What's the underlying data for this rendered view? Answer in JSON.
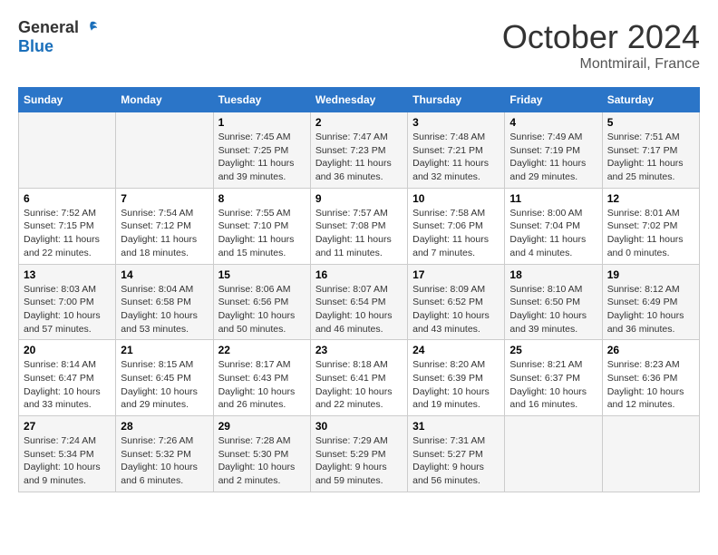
{
  "logo": {
    "general": "General",
    "blue": "Blue"
  },
  "header": {
    "month": "October 2024",
    "location": "Montmirail, France"
  },
  "weekdays": [
    "Sunday",
    "Monday",
    "Tuesday",
    "Wednesday",
    "Thursday",
    "Friday",
    "Saturday"
  ],
  "weeks": [
    [
      {
        "day": "",
        "sunrise": "",
        "sunset": "",
        "daylight": ""
      },
      {
        "day": "",
        "sunrise": "",
        "sunset": "",
        "daylight": ""
      },
      {
        "day": "1",
        "sunrise": "Sunrise: 7:45 AM",
        "sunset": "Sunset: 7:25 PM",
        "daylight": "Daylight: 11 hours and 39 minutes."
      },
      {
        "day": "2",
        "sunrise": "Sunrise: 7:47 AM",
        "sunset": "Sunset: 7:23 PM",
        "daylight": "Daylight: 11 hours and 36 minutes."
      },
      {
        "day": "3",
        "sunrise": "Sunrise: 7:48 AM",
        "sunset": "Sunset: 7:21 PM",
        "daylight": "Daylight: 11 hours and 32 minutes."
      },
      {
        "day": "4",
        "sunrise": "Sunrise: 7:49 AM",
        "sunset": "Sunset: 7:19 PM",
        "daylight": "Daylight: 11 hours and 29 minutes."
      },
      {
        "day": "5",
        "sunrise": "Sunrise: 7:51 AM",
        "sunset": "Sunset: 7:17 PM",
        "daylight": "Daylight: 11 hours and 25 minutes."
      }
    ],
    [
      {
        "day": "6",
        "sunrise": "Sunrise: 7:52 AM",
        "sunset": "Sunset: 7:15 PM",
        "daylight": "Daylight: 11 hours and 22 minutes."
      },
      {
        "day": "7",
        "sunrise": "Sunrise: 7:54 AM",
        "sunset": "Sunset: 7:12 PM",
        "daylight": "Daylight: 11 hours and 18 minutes."
      },
      {
        "day": "8",
        "sunrise": "Sunrise: 7:55 AM",
        "sunset": "Sunset: 7:10 PM",
        "daylight": "Daylight: 11 hours and 15 minutes."
      },
      {
        "day": "9",
        "sunrise": "Sunrise: 7:57 AM",
        "sunset": "Sunset: 7:08 PM",
        "daylight": "Daylight: 11 hours and 11 minutes."
      },
      {
        "day": "10",
        "sunrise": "Sunrise: 7:58 AM",
        "sunset": "Sunset: 7:06 PM",
        "daylight": "Daylight: 11 hours and 7 minutes."
      },
      {
        "day": "11",
        "sunrise": "Sunrise: 8:00 AM",
        "sunset": "Sunset: 7:04 PM",
        "daylight": "Daylight: 11 hours and 4 minutes."
      },
      {
        "day": "12",
        "sunrise": "Sunrise: 8:01 AM",
        "sunset": "Sunset: 7:02 PM",
        "daylight": "Daylight: 11 hours and 0 minutes."
      }
    ],
    [
      {
        "day": "13",
        "sunrise": "Sunrise: 8:03 AM",
        "sunset": "Sunset: 7:00 PM",
        "daylight": "Daylight: 10 hours and 57 minutes."
      },
      {
        "day": "14",
        "sunrise": "Sunrise: 8:04 AM",
        "sunset": "Sunset: 6:58 PM",
        "daylight": "Daylight: 10 hours and 53 minutes."
      },
      {
        "day": "15",
        "sunrise": "Sunrise: 8:06 AM",
        "sunset": "Sunset: 6:56 PM",
        "daylight": "Daylight: 10 hours and 50 minutes."
      },
      {
        "day": "16",
        "sunrise": "Sunrise: 8:07 AM",
        "sunset": "Sunset: 6:54 PM",
        "daylight": "Daylight: 10 hours and 46 minutes."
      },
      {
        "day": "17",
        "sunrise": "Sunrise: 8:09 AM",
        "sunset": "Sunset: 6:52 PM",
        "daylight": "Daylight: 10 hours and 43 minutes."
      },
      {
        "day": "18",
        "sunrise": "Sunrise: 8:10 AM",
        "sunset": "Sunset: 6:50 PM",
        "daylight": "Daylight: 10 hours and 39 minutes."
      },
      {
        "day": "19",
        "sunrise": "Sunrise: 8:12 AM",
        "sunset": "Sunset: 6:49 PM",
        "daylight": "Daylight: 10 hours and 36 minutes."
      }
    ],
    [
      {
        "day": "20",
        "sunrise": "Sunrise: 8:14 AM",
        "sunset": "Sunset: 6:47 PM",
        "daylight": "Daylight: 10 hours and 33 minutes."
      },
      {
        "day": "21",
        "sunrise": "Sunrise: 8:15 AM",
        "sunset": "Sunset: 6:45 PM",
        "daylight": "Daylight: 10 hours and 29 minutes."
      },
      {
        "day": "22",
        "sunrise": "Sunrise: 8:17 AM",
        "sunset": "Sunset: 6:43 PM",
        "daylight": "Daylight: 10 hours and 26 minutes."
      },
      {
        "day": "23",
        "sunrise": "Sunrise: 8:18 AM",
        "sunset": "Sunset: 6:41 PM",
        "daylight": "Daylight: 10 hours and 22 minutes."
      },
      {
        "day": "24",
        "sunrise": "Sunrise: 8:20 AM",
        "sunset": "Sunset: 6:39 PM",
        "daylight": "Daylight: 10 hours and 19 minutes."
      },
      {
        "day": "25",
        "sunrise": "Sunrise: 8:21 AM",
        "sunset": "Sunset: 6:37 PM",
        "daylight": "Daylight: 10 hours and 16 minutes."
      },
      {
        "day": "26",
        "sunrise": "Sunrise: 8:23 AM",
        "sunset": "Sunset: 6:36 PM",
        "daylight": "Daylight: 10 hours and 12 minutes."
      }
    ],
    [
      {
        "day": "27",
        "sunrise": "Sunrise: 7:24 AM",
        "sunset": "Sunset: 5:34 PM",
        "daylight": "Daylight: 10 hours and 9 minutes."
      },
      {
        "day": "28",
        "sunrise": "Sunrise: 7:26 AM",
        "sunset": "Sunset: 5:32 PM",
        "daylight": "Daylight: 10 hours and 6 minutes."
      },
      {
        "day": "29",
        "sunrise": "Sunrise: 7:28 AM",
        "sunset": "Sunset: 5:30 PM",
        "daylight": "Daylight: 10 hours and 2 minutes."
      },
      {
        "day": "30",
        "sunrise": "Sunrise: 7:29 AM",
        "sunset": "Sunset: 5:29 PM",
        "daylight": "Daylight: 9 hours and 59 minutes."
      },
      {
        "day": "31",
        "sunrise": "Sunrise: 7:31 AM",
        "sunset": "Sunset: 5:27 PM",
        "daylight": "Daylight: 9 hours and 56 minutes."
      },
      {
        "day": "",
        "sunrise": "",
        "sunset": "",
        "daylight": ""
      },
      {
        "day": "",
        "sunrise": "",
        "sunset": "",
        "daylight": ""
      }
    ]
  ]
}
